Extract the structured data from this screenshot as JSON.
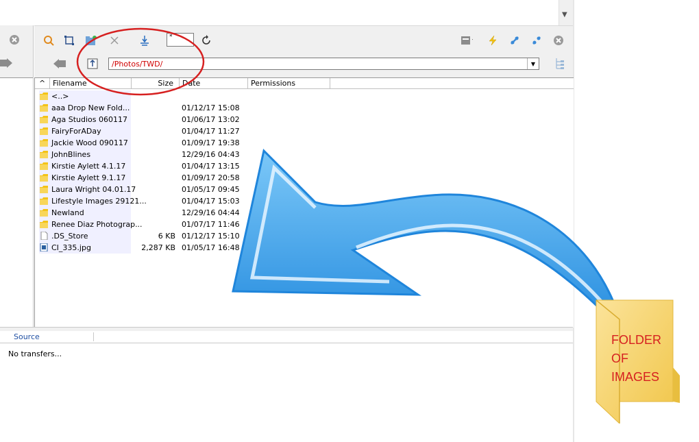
{
  "path": {
    "value": "/Photos/TWD/"
  },
  "filter": {
    "value": "*"
  },
  "columns": [
    "Filename",
    "Size",
    "Date",
    "Permissions"
  ],
  "sort_indicator": "^",
  "files": [
    {
      "name": "<..>",
      "size": "",
      "date": "",
      "type": "folder"
    },
    {
      "name": "aaa       Drop New Fold...",
      "size": "",
      "date": "01/12/17  15:08",
      "type": "folder"
    },
    {
      "name": "Aga Studios 060117",
      "size": "",
      "date": "01/06/17  13:02",
      "type": "folder"
    },
    {
      "name": "FairyForADay",
      "size": "",
      "date": "01/04/17  11:27",
      "type": "folder"
    },
    {
      "name": "Jackie Wood 090117",
      "size": "",
      "date": "01/09/17  19:38",
      "type": "folder"
    },
    {
      "name": "JohnBlines",
      "size": "",
      "date": "12/29/16  04:43",
      "type": "folder"
    },
    {
      "name": "Kirstie Aylett 4.1.17",
      "size": "",
      "date": "01/04/17  13:15",
      "type": "folder"
    },
    {
      "name": "Kirstie Aylett 9.1.17",
      "size": "",
      "date": "01/09/17  20:58",
      "type": "folder"
    },
    {
      "name": "Laura Wright 04.01.17",
      "size": "",
      "date": "01/05/17  09:45",
      "type": "folder"
    },
    {
      "name": "Lifestyle Images 29121...",
      "size": "",
      "date": "01/04/17  15:03",
      "type": "folder"
    },
    {
      "name": "Newland",
      "size": "",
      "date": "12/29/16  04:44",
      "type": "folder"
    },
    {
      "name": "Renee Diaz Photograp...",
      "size": "",
      "date": "01/07/17  11:46",
      "type": "folder"
    },
    {
      "name": ".DS_Store",
      "size": "6 KB",
      "date": "01/12/17  15:10",
      "type": "file"
    },
    {
      "name": "CI_335.jpg",
      "size": "2,287 KB",
      "date": "01/05/17  16:48",
      "type": "image"
    }
  ],
  "transfer_queue": {
    "column_source": "Source",
    "empty_text": "No transfers..."
  },
  "overlay": {
    "folder_label_lines": [
      "FOLDER",
      "OF",
      "IMAGES"
    ]
  },
  "colors": {
    "annotation_red": "#d62020",
    "path_red": "#d00000",
    "arrow_blue": "#3aa3ee",
    "folder_yellow": "#f5d061"
  },
  "icons": [
    "search-icon",
    "select-icon",
    "new-folder-icon",
    "delete-icon",
    "filter-icon",
    "refresh-icon",
    "server-icon",
    "lightning-icon",
    "connect-icon",
    "disconnect-icon",
    "close-icon",
    "back-icon",
    "parent-folder-icon",
    "tree-view-icon"
  ]
}
